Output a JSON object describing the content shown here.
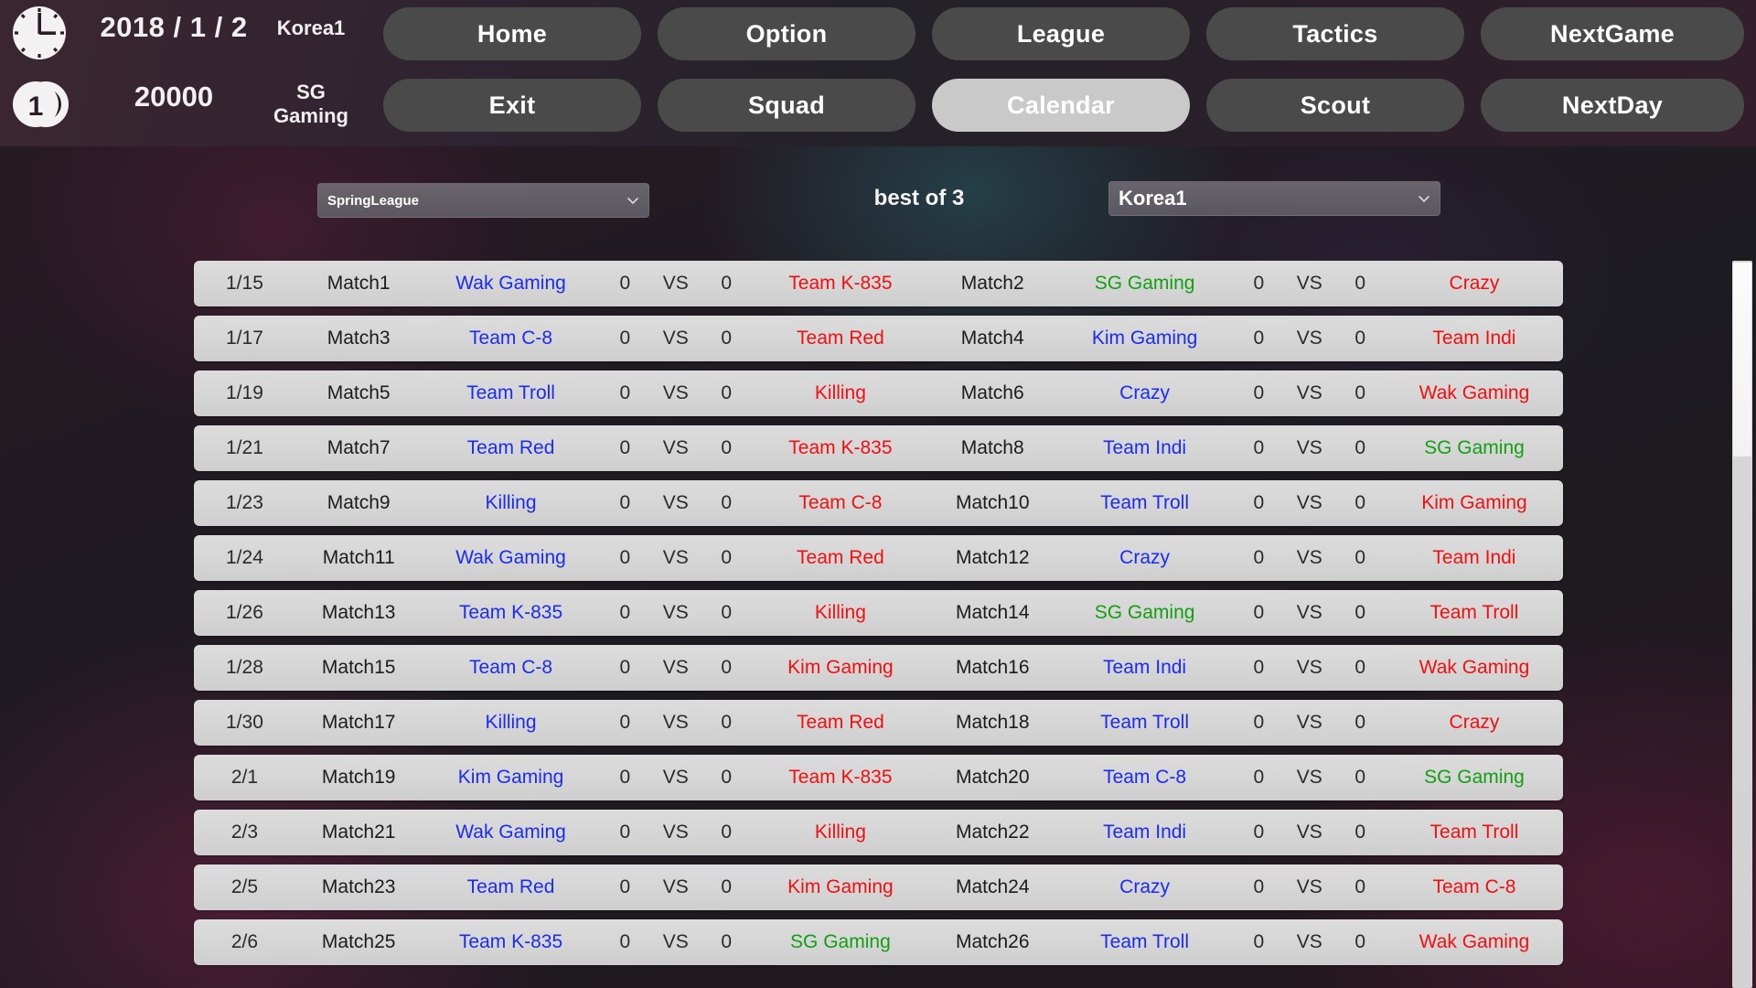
{
  "status": {
    "clock_icon": "clock-icon",
    "coin_icon": "coin-icon",
    "date": "2018 / 1 / 2",
    "money": "20000",
    "region": "Korea1",
    "team": "SG Gaming"
  },
  "nav": {
    "row1": [
      {
        "label": "Home",
        "name": "home",
        "active": false
      },
      {
        "label": "Option",
        "name": "option",
        "active": false
      },
      {
        "label": "League",
        "name": "league",
        "active": false
      },
      {
        "label": "Tactics",
        "name": "tactics",
        "active": false
      },
      {
        "label": "NextGame",
        "name": "nextgame",
        "active": false
      }
    ],
    "row2": [
      {
        "label": "Exit",
        "name": "exit",
        "active": false
      },
      {
        "label": "Squad",
        "name": "squad",
        "active": false
      },
      {
        "label": "Calendar",
        "name": "calendar",
        "active": true
      },
      {
        "label": "Scout",
        "name": "scout",
        "active": false
      },
      {
        "label": "NextDay",
        "name": "nextday",
        "active": false
      }
    ]
  },
  "filters": {
    "league_value": "SpringLeague",
    "region_value": "Korea1",
    "best_of": "best of 3",
    "chevron_icon": "chevron-down-icon"
  },
  "table": {
    "vs_label": "VS",
    "colors": {
      "left_team": "#1a2cf0",
      "right_team": "#f01010",
      "own_team": "#12a012",
      "row_bg": "#d6d5d6"
    },
    "own_team": "SG Gaming",
    "rows": [
      {
        "date": "1/15",
        "a": {
          "match": "Match1",
          "left": "Wak Gaming",
          "left_color": "blue",
          "ls": "0",
          "rs": "0",
          "right": "Team K-835",
          "right_color": "red"
        },
        "b": {
          "match": "Match2",
          "left": "SG Gaming",
          "left_color": "green",
          "ls": "0",
          "rs": "0",
          "right": "Crazy",
          "right_color": "red"
        }
      },
      {
        "date": "1/17",
        "a": {
          "match": "Match3",
          "left": "Team C-8",
          "left_color": "blue",
          "ls": "0",
          "rs": "0",
          "right": "Team Red",
          "right_color": "red"
        },
        "b": {
          "match": "Match4",
          "left": "Kim Gaming",
          "left_color": "blue",
          "ls": "0",
          "rs": "0",
          "right": "Team Indi",
          "right_color": "red"
        }
      },
      {
        "date": "1/19",
        "a": {
          "match": "Match5",
          "left": "Team Troll",
          "left_color": "blue",
          "ls": "0",
          "rs": "0",
          "right": "Killing",
          "right_color": "red"
        },
        "b": {
          "match": "Match6",
          "left": "Crazy",
          "left_color": "blue",
          "ls": "0",
          "rs": "0",
          "right": "Wak Gaming",
          "right_color": "red"
        }
      },
      {
        "date": "1/21",
        "a": {
          "match": "Match7",
          "left": "Team Red",
          "left_color": "blue",
          "ls": "0",
          "rs": "0",
          "right": "Team K-835",
          "right_color": "red"
        },
        "b": {
          "match": "Match8",
          "left": "Team Indi",
          "left_color": "blue",
          "ls": "0",
          "rs": "0",
          "right": "SG Gaming",
          "right_color": "green"
        }
      },
      {
        "date": "1/23",
        "a": {
          "match": "Match9",
          "left": "Killing",
          "left_color": "blue",
          "ls": "0",
          "rs": "0",
          "right": "Team C-8",
          "right_color": "red"
        },
        "b": {
          "match": "Match10",
          "left": "Team Troll",
          "left_color": "blue",
          "ls": "0",
          "rs": "0",
          "right": "Kim Gaming",
          "right_color": "red"
        }
      },
      {
        "date": "1/24",
        "a": {
          "match": "Match11",
          "left": "Wak Gaming",
          "left_color": "blue",
          "ls": "0",
          "rs": "0",
          "right": "Team Red",
          "right_color": "red"
        },
        "b": {
          "match": "Match12",
          "left": "Crazy",
          "left_color": "blue",
          "ls": "0",
          "rs": "0",
          "right": "Team Indi",
          "right_color": "red"
        }
      },
      {
        "date": "1/26",
        "a": {
          "match": "Match13",
          "left": "Team K-835",
          "left_color": "blue",
          "ls": "0",
          "rs": "0",
          "right": "Killing",
          "right_color": "red"
        },
        "b": {
          "match": "Match14",
          "left": "SG Gaming",
          "left_color": "green",
          "ls": "0",
          "rs": "0",
          "right": "Team Troll",
          "right_color": "red"
        }
      },
      {
        "date": "1/28",
        "a": {
          "match": "Match15",
          "left": "Team C-8",
          "left_color": "blue",
          "ls": "0",
          "rs": "0",
          "right": "Kim Gaming",
          "right_color": "red"
        },
        "b": {
          "match": "Match16",
          "left": "Team Indi",
          "left_color": "blue",
          "ls": "0",
          "rs": "0",
          "right": "Wak Gaming",
          "right_color": "red"
        }
      },
      {
        "date": "1/30",
        "a": {
          "match": "Match17",
          "left": "Killing",
          "left_color": "blue",
          "ls": "0",
          "rs": "0",
          "right": "Team Red",
          "right_color": "red"
        },
        "b": {
          "match": "Match18",
          "left": "Team Troll",
          "left_color": "blue",
          "ls": "0",
          "rs": "0",
          "right": "Crazy",
          "right_color": "red"
        }
      },
      {
        "date": "2/1",
        "a": {
          "match": "Match19",
          "left": "Kim Gaming",
          "left_color": "blue",
          "ls": "0",
          "rs": "0",
          "right": "Team K-835",
          "right_color": "red"
        },
        "b": {
          "match": "Match20",
          "left": "Team C-8",
          "left_color": "blue",
          "ls": "0",
          "rs": "0",
          "right": "SG Gaming",
          "right_color": "green"
        }
      },
      {
        "date": "2/3",
        "a": {
          "match": "Match21",
          "left": "Wak Gaming",
          "left_color": "blue",
          "ls": "0",
          "rs": "0",
          "right": "Killing",
          "right_color": "red"
        },
        "b": {
          "match": "Match22",
          "left": "Team Indi",
          "left_color": "blue",
          "ls": "0",
          "rs": "0",
          "right": "Team Troll",
          "right_color": "red"
        }
      },
      {
        "date": "2/5",
        "a": {
          "match": "Match23",
          "left": "Team Red",
          "left_color": "blue",
          "ls": "0",
          "rs": "0",
          "right": "Kim Gaming",
          "right_color": "red"
        },
        "b": {
          "match": "Match24",
          "left": "Crazy",
          "left_color": "blue",
          "ls": "0",
          "rs": "0",
          "right": "Team C-8",
          "right_color": "red"
        }
      },
      {
        "date": "2/6",
        "a": {
          "match": "Match25",
          "left": "Team K-835",
          "left_color": "blue",
          "ls": "0",
          "rs": "0",
          "right": "SG Gaming",
          "right_color": "green"
        },
        "b": {
          "match": "Match26",
          "left": "Team Troll",
          "left_color": "blue",
          "ls": "0",
          "rs": "0",
          "right": "Wak Gaming",
          "right_color": "red"
        }
      }
    ]
  }
}
